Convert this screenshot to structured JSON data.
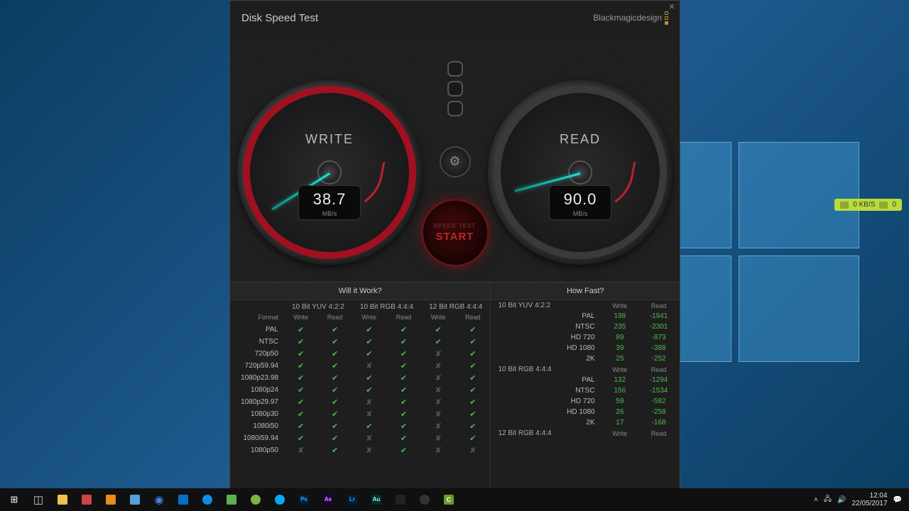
{
  "app": {
    "title": "Disk Speed Test",
    "brand": "Blackmagicdesign"
  },
  "gauges": {
    "write": {
      "label": "WRITE",
      "value": "38.7",
      "unit": "MB/s"
    },
    "read": {
      "label": "READ",
      "value": "90.0",
      "unit": "MB/s"
    }
  },
  "center": {
    "gear_icon": "gear-icon",
    "start_small": "SPEED TEST",
    "start_big": "START"
  },
  "panels": {
    "work_title": "Will it Work?",
    "fast_title": "How Fast?"
  },
  "work": {
    "groups": [
      "10 Bit YUV 4:2:2",
      "10 Bit RGB 4:4:4",
      "12 Bit RGB 4:4:4"
    ],
    "subheads": [
      "Format",
      "Write",
      "Read",
      "Write",
      "Read",
      "Write",
      "Read"
    ],
    "rows": [
      {
        "fmt": "PAL",
        "c": [
          "y",
          "y",
          "y",
          "y",
          "y",
          "y"
        ]
      },
      {
        "fmt": "NTSC",
        "c": [
          "y",
          "y",
          "y",
          "y",
          "y",
          "y"
        ]
      },
      {
        "fmt": "720p50",
        "c": [
          "y",
          "y",
          "y",
          "y",
          "x",
          "y"
        ]
      },
      {
        "fmt": "720p59.94",
        "c": [
          "y",
          "y",
          "x",
          "y",
          "x",
          "y"
        ]
      },
      {
        "fmt": "1080p23.98",
        "c": [
          "y",
          "y",
          "y",
          "y",
          "x",
          "y"
        ]
      },
      {
        "fmt": "1080p24",
        "c": [
          "y",
          "y",
          "y",
          "y",
          "x",
          "y"
        ]
      },
      {
        "fmt": "1080p29.97",
        "c": [
          "y",
          "y",
          "x",
          "y",
          "x",
          "y"
        ]
      },
      {
        "fmt": "1080p30",
        "c": [
          "y",
          "y",
          "x",
          "y",
          "x",
          "y"
        ]
      },
      {
        "fmt": "1080i50",
        "c": [
          "y",
          "y",
          "y",
          "y",
          "x",
          "y"
        ]
      },
      {
        "fmt": "1080i59.94",
        "c": [
          "y",
          "y",
          "x",
          "y",
          "x",
          "y"
        ]
      },
      {
        "fmt": "1080p50",
        "c": [
          "x",
          "y",
          "x",
          "y",
          "x",
          "x"
        ]
      }
    ]
  },
  "fast": {
    "subheads": [
      "Write",
      "Read"
    ],
    "sections": [
      {
        "title": "10 Bit YUV 4:2:2",
        "rows": [
          {
            "fmt": "PAL",
            "w": "198",
            "r": "-1941"
          },
          {
            "fmt": "NTSC",
            "w": "235",
            "r": "-2301"
          },
          {
            "fmt": "HD 720",
            "w": "89",
            "r": "-873"
          },
          {
            "fmt": "HD 1080",
            "w": "39",
            "r": "-388"
          },
          {
            "fmt": "2K",
            "w": "25",
            "r": "-252"
          }
        ]
      },
      {
        "title": "10 Bit RGB 4:4:4",
        "rows": [
          {
            "fmt": "PAL",
            "w": "132",
            "r": "-1294"
          },
          {
            "fmt": "NTSC",
            "w": "156",
            "r": "-1534"
          },
          {
            "fmt": "HD 720",
            "w": "59",
            "r": "-582"
          },
          {
            "fmt": "HD 1080",
            "w": "26",
            "r": "-258"
          },
          {
            "fmt": "2K",
            "w": "17",
            "r": "-168"
          }
        ]
      },
      {
        "title": "12 Bit RGB 4:4:4",
        "rows": []
      }
    ]
  },
  "net_widget": {
    "speed": "0 KB/S",
    "count": "0"
  },
  "taskbar": {
    "time": "12:04",
    "date": "22/05/2017"
  }
}
